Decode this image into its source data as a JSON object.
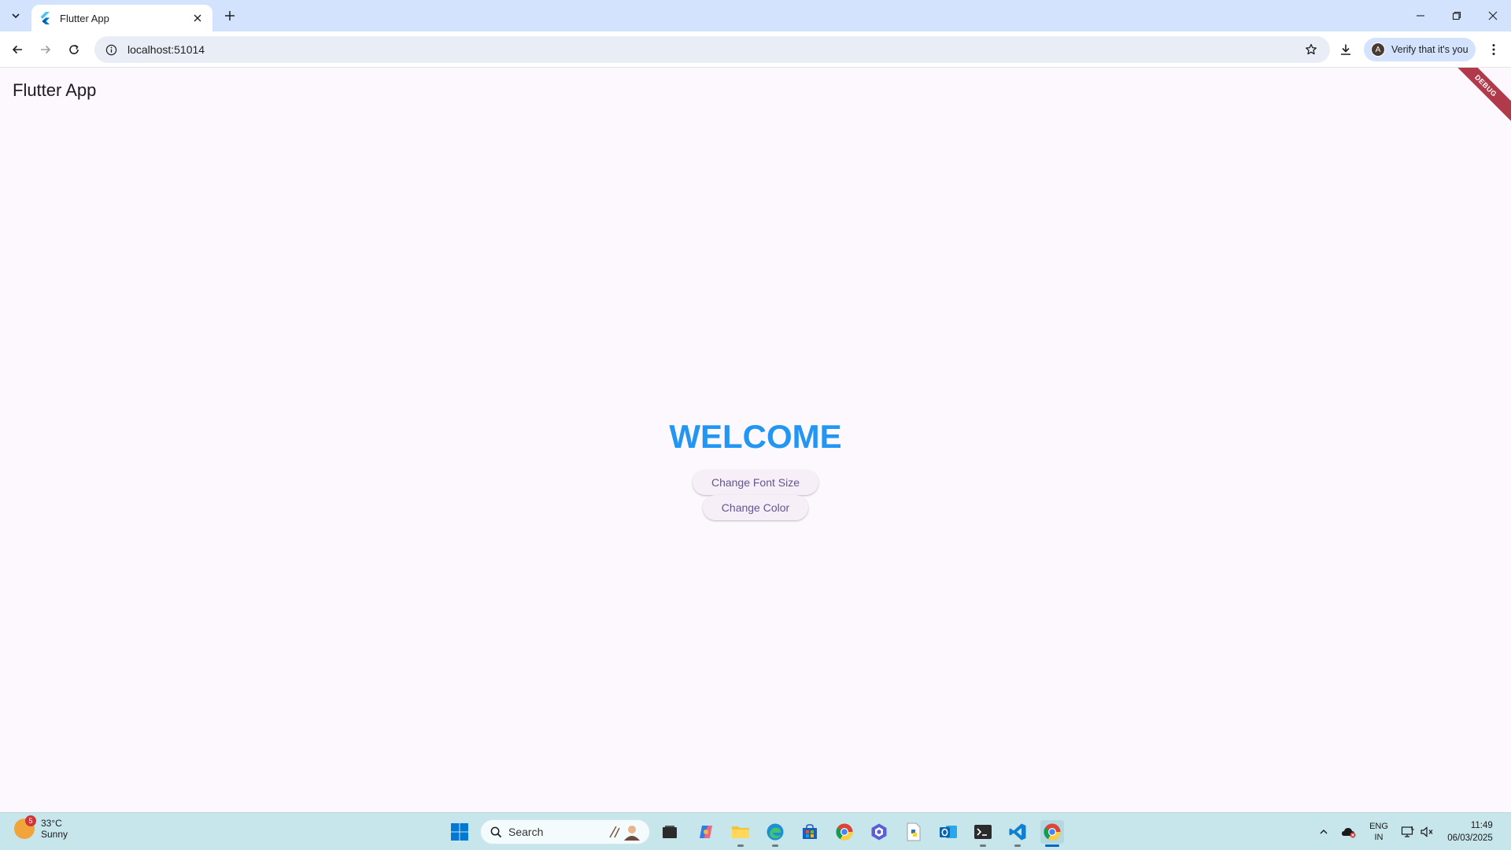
{
  "browser": {
    "tab_title": "Flutter App",
    "address": "localhost:51014",
    "verify_label": "Verify that it's you",
    "profile_initial": "A"
  },
  "app": {
    "title": "Flutter App",
    "debug_label": "DEBUG",
    "heading": "WELCOME",
    "heading_color": "#2196f3",
    "buttons": {
      "font_size": "Change Font Size",
      "color": "Change Color"
    }
  },
  "taskbar": {
    "weather_temp": "33°C",
    "weather_condition": "Sunny",
    "weather_badge": "5",
    "search_label": "Search",
    "lang_line1": "ENG",
    "lang_line2": "IN",
    "time": "11:49",
    "date": "06/03/2025"
  }
}
